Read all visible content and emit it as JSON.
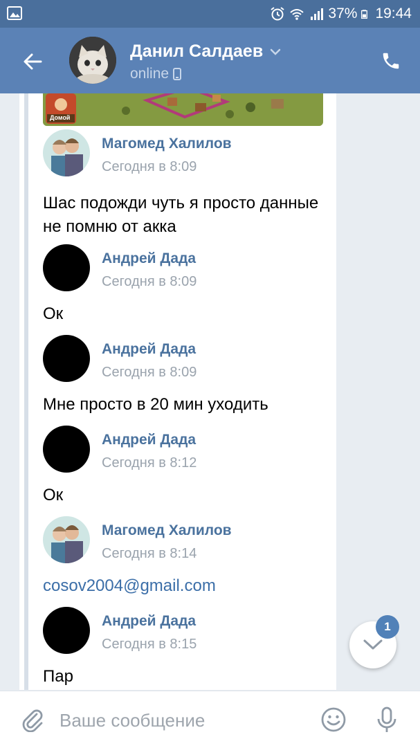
{
  "status_bar": {
    "battery": "37%",
    "time": "19:44"
  },
  "header": {
    "contact_name": "Данил Салдаев",
    "status": "online"
  },
  "messages": [
    {
      "author": "Магомед Халилов",
      "time": "Сегодня в 8:09",
      "text": "Шас подожди чуть я просто данные не помню от акка",
      "avatar": "photo"
    },
    {
      "author": "Андрей Дада",
      "time": "Сегодня в 8:09",
      "text": "Ок",
      "avatar": "black"
    },
    {
      "author": "Андрей Дада",
      "time": "Сегодня в 8:09",
      "text": "Мне просто в 20 мин уходить",
      "avatar": "black"
    },
    {
      "author": "Андрей Дада",
      "time": "Сегодня в 8:12",
      "text": "Ок",
      "avatar": "black"
    },
    {
      "author": "Магомед Халилов",
      "time": "Сегодня в 8:14",
      "text": "cosov2004@gmail.com",
      "avatar": "photo"
    },
    {
      "author": "Андрей Дада",
      "time": "Сегодня в 8:15",
      "text": "Пар",
      "avatar": "black"
    }
  ],
  "game_image": {
    "caption": "Домой"
  },
  "scroll_down": {
    "unread_count": "1"
  },
  "composer": {
    "placeholder": "Ваше сообщение"
  },
  "colors": {
    "status_bar": "#4a6f9c",
    "header": "#5b82b6",
    "author_name": "#4a729e",
    "link": "#3b6ea8",
    "badge": "#5181b8"
  }
}
